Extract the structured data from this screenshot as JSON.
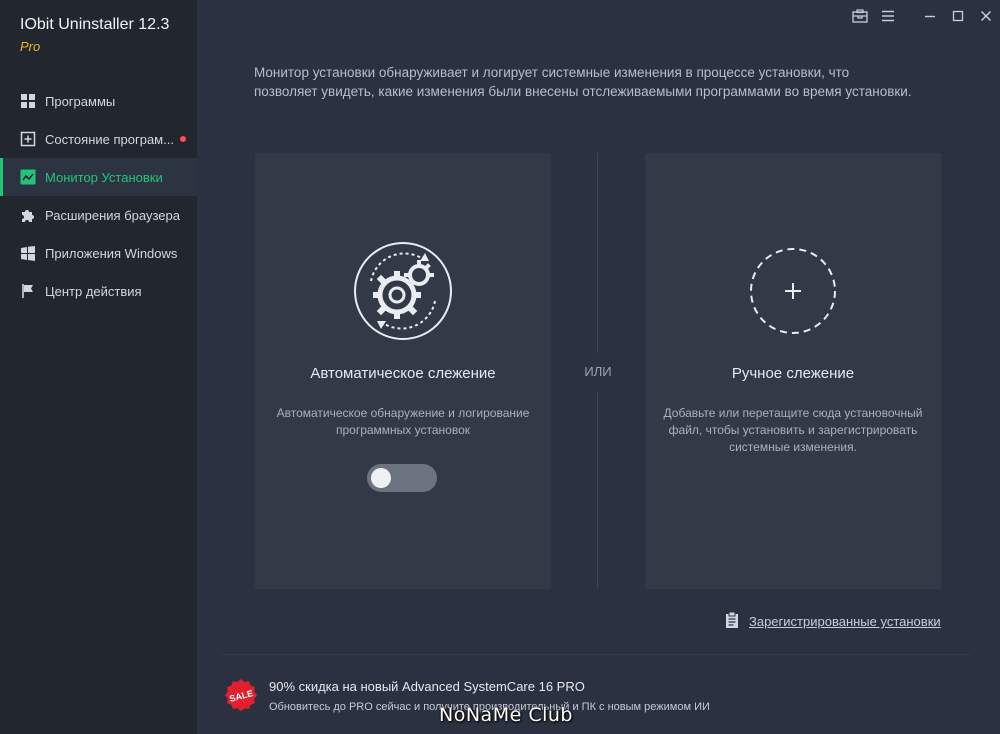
{
  "app": {
    "title": "IObit Uninstaller 12.3",
    "edition": "Pro"
  },
  "sidebar": {
    "items": [
      {
        "label": "Программы",
        "icon": "grid-icon",
        "active": false
      },
      {
        "label": "Состояние програм...",
        "icon": "plus-square-icon",
        "active": false,
        "badge": true
      },
      {
        "label": "Монитор Установки",
        "icon": "chart-line-icon",
        "active": true
      },
      {
        "label": "Расширения браузера",
        "icon": "puzzle-icon",
        "active": false
      },
      {
        "label": "Приложения Windows",
        "icon": "windows-icon",
        "active": false
      },
      {
        "label": "Центр действия",
        "icon": "flag-icon",
        "active": false
      }
    ]
  },
  "window_controls": [
    "toolbox-icon",
    "menu-icon",
    "minimize-icon",
    "maximize-icon",
    "close-icon"
  ],
  "main": {
    "intro": "Монитор установки обнаруживает и логирует системные изменения в процессе установки, что позволяет увидеть, какие изменения были внесены отслеживаемыми программами во время установки.",
    "auto": {
      "title": "Автоматическое слежение",
      "description": "Автоматическое обнаружение и логирование программных установок",
      "toggle_on": false,
      "icon": "gears-cycle-icon"
    },
    "or_label": "ИЛИ",
    "manual": {
      "title": "Ручное слежение",
      "description": "Добавьте или перетащите сюда установочный файл, чтобы установить и зарегистрировать системные изменения.",
      "icon": "add-circle-icon"
    },
    "registered_link": "Зарегистрированные установки"
  },
  "promo": {
    "badge": "SALE",
    "title": "90% скидка на новый Advanced SystemCare 16 PRO",
    "subtitle": "Обновитесь до PRO сейчас и получите производительный и ПК с новым режимом ИИ"
  },
  "watermark": "NoNaMe Club",
  "colors": {
    "accent": "#22c47a",
    "edition": "#e8b823",
    "sidebar_bg": "#22272f",
    "main_bg": "#2b3140",
    "card_bg": "#323a48",
    "badge_red": "#e0202e"
  }
}
